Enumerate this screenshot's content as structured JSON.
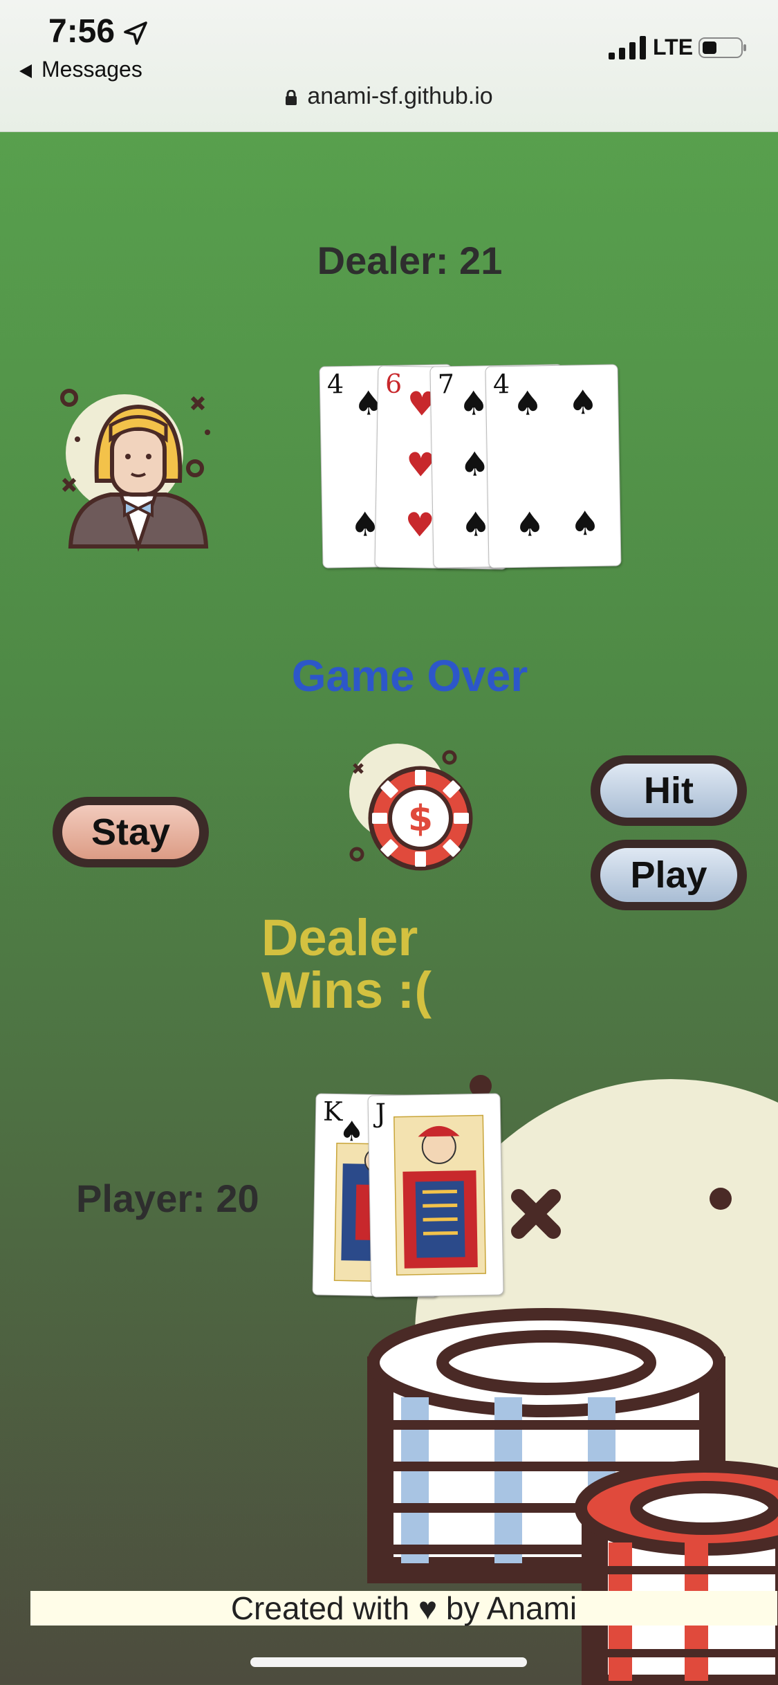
{
  "status": {
    "time": "7:56",
    "back_label": "Messages",
    "network": "LTE"
  },
  "browser": {
    "url": "anami-sf.github.io"
  },
  "game": {
    "dealer_score": "Dealer: 21",
    "player_score": "Player: 20",
    "status": "Game Over",
    "result": "Dealer Wins :("
  },
  "buttons": {
    "stay": "Stay",
    "hit": "Hit",
    "play": "Play"
  },
  "dealer_cards": [
    {
      "rank": "4",
      "suit": "♠",
      "color": "black"
    },
    {
      "rank": "6",
      "suit": "♥",
      "color": "red"
    },
    {
      "rank": "7",
      "suit": "♠",
      "color": "black"
    },
    {
      "rank": "4",
      "suit": "♠",
      "color": "black"
    }
  ],
  "player_cards": [
    {
      "rank": "K",
      "suit": "♠",
      "color": "black"
    },
    {
      "rank": "J",
      "suit": "♣",
      "color": "black"
    }
  ],
  "colors": {
    "felt_top": "#5aa54f",
    "felt_bottom": "#4d4c3e",
    "status_blue": "#2d57c9",
    "result_yellow": "#d3c140"
  },
  "footer": {
    "text": "Created with ♥ by Anami"
  }
}
